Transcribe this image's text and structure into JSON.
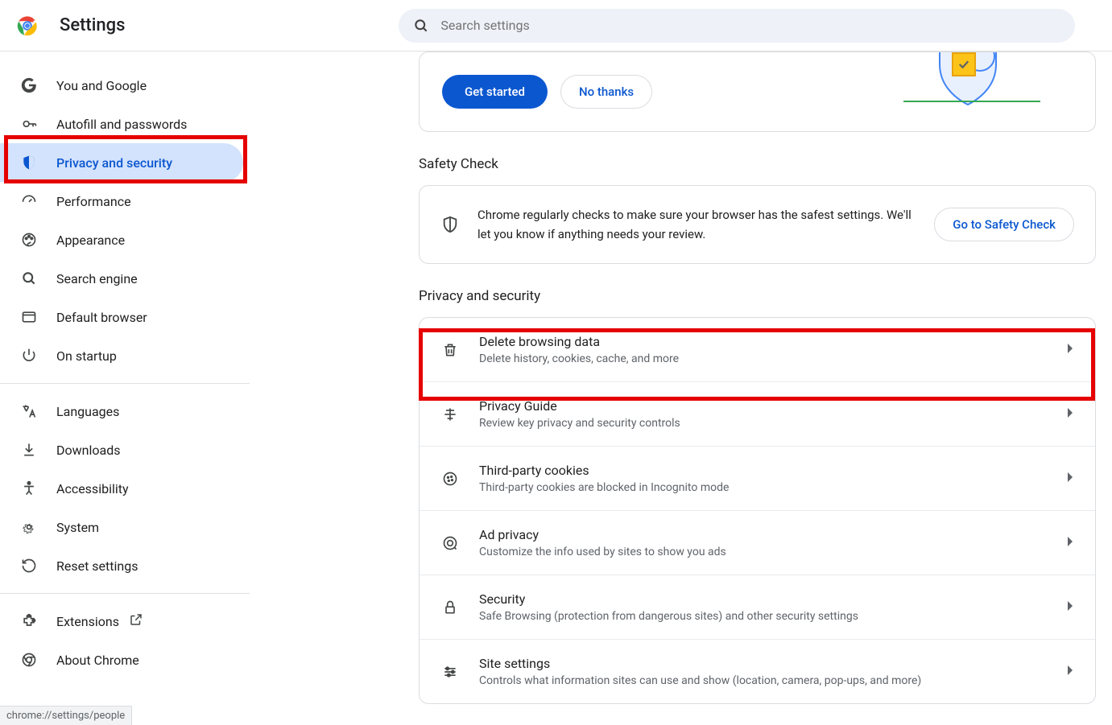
{
  "header": {
    "title": "Settings",
    "search_placeholder": "Search settings"
  },
  "sidebar": {
    "groups": [
      [
        {
          "icon": "google",
          "label": "You and Google"
        },
        {
          "icon": "key",
          "label": "Autofill and passwords"
        },
        {
          "icon": "shield",
          "label": "Privacy and security",
          "active": true,
          "highlighted": true
        },
        {
          "icon": "performance",
          "label": "Performance"
        },
        {
          "icon": "appearance",
          "label": "Appearance"
        },
        {
          "icon": "search",
          "label": "Search engine"
        },
        {
          "icon": "browser",
          "label": "Default browser"
        },
        {
          "icon": "power",
          "label": "On startup"
        }
      ],
      [
        {
          "icon": "language",
          "label": "Languages"
        },
        {
          "icon": "download",
          "label": "Downloads"
        },
        {
          "icon": "accessibility",
          "label": "Accessibility"
        },
        {
          "icon": "system",
          "label": "System"
        },
        {
          "icon": "reset",
          "label": "Reset settings"
        }
      ],
      [
        {
          "icon": "extensions",
          "label": "Extensions",
          "external": true
        },
        {
          "icon": "chrome",
          "label": "About Chrome"
        }
      ]
    ]
  },
  "main": {
    "promo": {
      "get_started": "Get started",
      "no_thanks": "No thanks"
    },
    "safety_check": {
      "heading": "Safety Check",
      "text": "Chrome regularly checks to make sure your browser has the safest settings. We'll let you know if anything needs your review.",
      "button": "Go to Safety Check"
    },
    "privacy_section": {
      "heading": "Privacy and security",
      "rows": [
        {
          "icon": "trash",
          "title": "Delete browsing data",
          "subtitle": "Delete history, cookies, cache, and more",
          "highlighted": true
        },
        {
          "icon": "guide",
          "title": "Privacy Guide",
          "subtitle": "Review key privacy and security controls"
        },
        {
          "icon": "cookie",
          "title": "Third-party cookies",
          "subtitle": "Third-party cookies are blocked in Incognito mode"
        },
        {
          "icon": "adprivacy",
          "title": "Ad privacy",
          "subtitle": "Customize the info used by sites to show you ads"
        },
        {
          "icon": "lock",
          "title": "Security",
          "subtitle": "Safe Browsing (protection from dangerous sites) and other security settings"
        },
        {
          "icon": "sliders",
          "title": "Site settings",
          "subtitle": "Controls what information sites can use and show (location, camera, pop-ups, and more)"
        }
      ]
    }
  },
  "status_bar": "chrome://settings/people"
}
